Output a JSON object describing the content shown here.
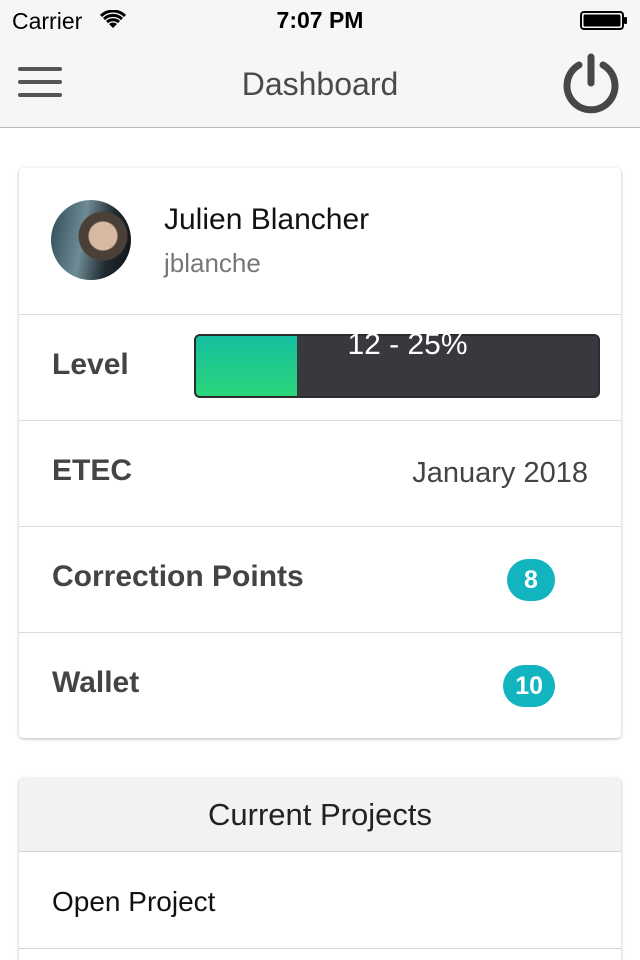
{
  "status_bar": {
    "carrier": "Carrier",
    "time": "7:07 PM",
    "wifi_icon": "wifi-icon",
    "battery_icon": "battery-icon"
  },
  "nav": {
    "title": "Dashboard",
    "menu_icon": "hamburger-menu-icon",
    "power_icon": "power-icon"
  },
  "profile": {
    "name": "Julien Blancher",
    "login": "jblanche"
  },
  "stats": {
    "level": {
      "label": "Level",
      "text": "12 - 25%",
      "progress": 0.25
    },
    "etec": {
      "label": "ETEC",
      "value": "January 2018"
    },
    "correction_points": {
      "label": "Correction Points",
      "value": "8"
    },
    "wallet": {
      "label": "Wallet",
      "value": "10"
    }
  },
  "projects": {
    "header": "Current Projects",
    "items": [
      "Open Project"
    ]
  },
  "colors": {
    "accent": "#12b5bf",
    "progress_fill": "#2bd67a",
    "progress_track": "#38383f"
  }
}
